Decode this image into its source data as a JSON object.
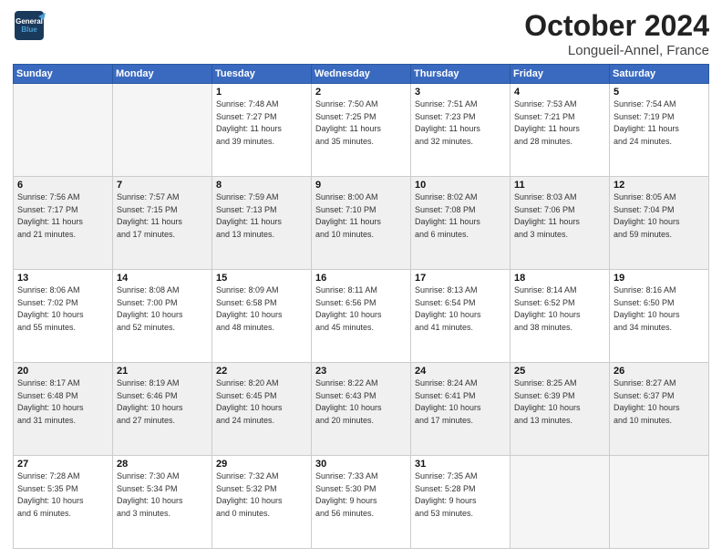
{
  "header": {
    "logo_line1": "General",
    "logo_line2": "Blue",
    "month": "October 2024",
    "location": "Longueil-Annel, France"
  },
  "weekdays": [
    "Sunday",
    "Monday",
    "Tuesday",
    "Wednesday",
    "Thursday",
    "Friday",
    "Saturday"
  ],
  "rows": [
    [
      {
        "day": "",
        "info": ""
      },
      {
        "day": "",
        "info": ""
      },
      {
        "day": "1",
        "info": "Sunrise: 7:48 AM\nSunset: 7:27 PM\nDaylight: 11 hours\nand 39 minutes."
      },
      {
        "day": "2",
        "info": "Sunrise: 7:50 AM\nSunset: 7:25 PM\nDaylight: 11 hours\nand 35 minutes."
      },
      {
        "day": "3",
        "info": "Sunrise: 7:51 AM\nSunset: 7:23 PM\nDaylight: 11 hours\nand 32 minutes."
      },
      {
        "day": "4",
        "info": "Sunrise: 7:53 AM\nSunset: 7:21 PM\nDaylight: 11 hours\nand 28 minutes."
      },
      {
        "day": "5",
        "info": "Sunrise: 7:54 AM\nSunset: 7:19 PM\nDaylight: 11 hours\nand 24 minutes."
      }
    ],
    [
      {
        "day": "6",
        "info": "Sunrise: 7:56 AM\nSunset: 7:17 PM\nDaylight: 11 hours\nand 21 minutes."
      },
      {
        "day": "7",
        "info": "Sunrise: 7:57 AM\nSunset: 7:15 PM\nDaylight: 11 hours\nand 17 minutes."
      },
      {
        "day": "8",
        "info": "Sunrise: 7:59 AM\nSunset: 7:13 PM\nDaylight: 11 hours\nand 13 minutes."
      },
      {
        "day": "9",
        "info": "Sunrise: 8:00 AM\nSunset: 7:10 PM\nDaylight: 11 hours\nand 10 minutes."
      },
      {
        "day": "10",
        "info": "Sunrise: 8:02 AM\nSunset: 7:08 PM\nDaylight: 11 hours\nand 6 minutes."
      },
      {
        "day": "11",
        "info": "Sunrise: 8:03 AM\nSunset: 7:06 PM\nDaylight: 11 hours\nand 3 minutes."
      },
      {
        "day": "12",
        "info": "Sunrise: 8:05 AM\nSunset: 7:04 PM\nDaylight: 10 hours\nand 59 minutes."
      }
    ],
    [
      {
        "day": "13",
        "info": "Sunrise: 8:06 AM\nSunset: 7:02 PM\nDaylight: 10 hours\nand 55 minutes."
      },
      {
        "day": "14",
        "info": "Sunrise: 8:08 AM\nSunset: 7:00 PM\nDaylight: 10 hours\nand 52 minutes."
      },
      {
        "day": "15",
        "info": "Sunrise: 8:09 AM\nSunset: 6:58 PM\nDaylight: 10 hours\nand 48 minutes."
      },
      {
        "day": "16",
        "info": "Sunrise: 8:11 AM\nSunset: 6:56 PM\nDaylight: 10 hours\nand 45 minutes."
      },
      {
        "day": "17",
        "info": "Sunrise: 8:13 AM\nSunset: 6:54 PM\nDaylight: 10 hours\nand 41 minutes."
      },
      {
        "day": "18",
        "info": "Sunrise: 8:14 AM\nSunset: 6:52 PM\nDaylight: 10 hours\nand 38 minutes."
      },
      {
        "day": "19",
        "info": "Sunrise: 8:16 AM\nSunset: 6:50 PM\nDaylight: 10 hours\nand 34 minutes."
      }
    ],
    [
      {
        "day": "20",
        "info": "Sunrise: 8:17 AM\nSunset: 6:48 PM\nDaylight: 10 hours\nand 31 minutes."
      },
      {
        "day": "21",
        "info": "Sunrise: 8:19 AM\nSunset: 6:46 PM\nDaylight: 10 hours\nand 27 minutes."
      },
      {
        "day": "22",
        "info": "Sunrise: 8:20 AM\nSunset: 6:45 PM\nDaylight: 10 hours\nand 24 minutes."
      },
      {
        "day": "23",
        "info": "Sunrise: 8:22 AM\nSunset: 6:43 PM\nDaylight: 10 hours\nand 20 minutes."
      },
      {
        "day": "24",
        "info": "Sunrise: 8:24 AM\nSunset: 6:41 PM\nDaylight: 10 hours\nand 17 minutes."
      },
      {
        "day": "25",
        "info": "Sunrise: 8:25 AM\nSunset: 6:39 PM\nDaylight: 10 hours\nand 13 minutes."
      },
      {
        "day": "26",
        "info": "Sunrise: 8:27 AM\nSunset: 6:37 PM\nDaylight: 10 hours\nand 10 minutes."
      }
    ],
    [
      {
        "day": "27",
        "info": "Sunrise: 7:28 AM\nSunset: 5:35 PM\nDaylight: 10 hours\nand 6 minutes."
      },
      {
        "day": "28",
        "info": "Sunrise: 7:30 AM\nSunset: 5:34 PM\nDaylight: 10 hours\nand 3 minutes."
      },
      {
        "day": "29",
        "info": "Sunrise: 7:32 AM\nSunset: 5:32 PM\nDaylight: 10 hours\nand 0 minutes."
      },
      {
        "day": "30",
        "info": "Sunrise: 7:33 AM\nSunset: 5:30 PM\nDaylight: 9 hours\nand 56 minutes."
      },
      {
        "day": "31",
        "info": "Sunrise: 7:35 AM\nSunset: 5:28 PM\nDaylight: 9 hours\nand 53 minutes."
      },
      {
        "day": "",
        "info": ""
      },
      {
        "day": "",
        "info": ""
      }
    ]
  ]
}
